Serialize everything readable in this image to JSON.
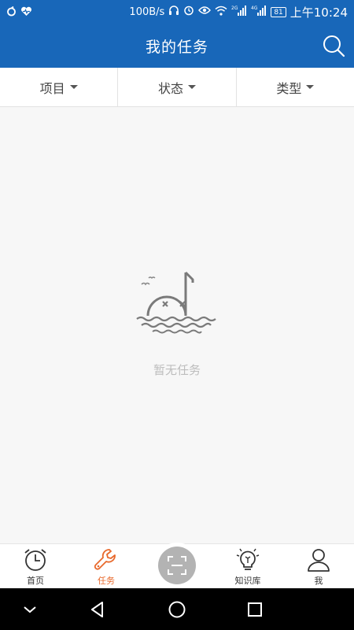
{
  "status_bar": {
    "left_icons": [
      "notification-icon",
      "health-icon"
    ],
    "network_speed": "100B/s",
    "signal_2g": "2G",
    "signal_4g": "4G",
    "battery": "81",
    "time": "上午10:24"
  },
  "header": {
    "title": "我的任务",
    "search_icon": "search-icon"
  },
  "filters": [
    {
      "label": "项目"
    },
    {
      "label": "状态"
    },
    {
      "label": "类型"
    }
  ],
  "empty_state": {
    "message": "暂无任务",
    "illustration": "sinking-music-note-illustration"
  },
  "bottom_nav": {
    "items": [
      {
        "label": "首页",
        "icon": "alarm-clock-icon"
      },
      {
        "label": "任务",
        "icon": "wrench-icon",
        "active": true
      },
      {
        "label": "知识库",
        "icon": "lightbulb-icon"
      },
      {
        "label": "我",
        "icon": "user-icon"
      }
    ],
    "scan_icon": "scan-icon"
  },
  "colors": {
    "brand_blue": "#1867b9",
    "active_orange": "#e8692c",
    "empty_gray": "#bdbdbd"
  }
}
